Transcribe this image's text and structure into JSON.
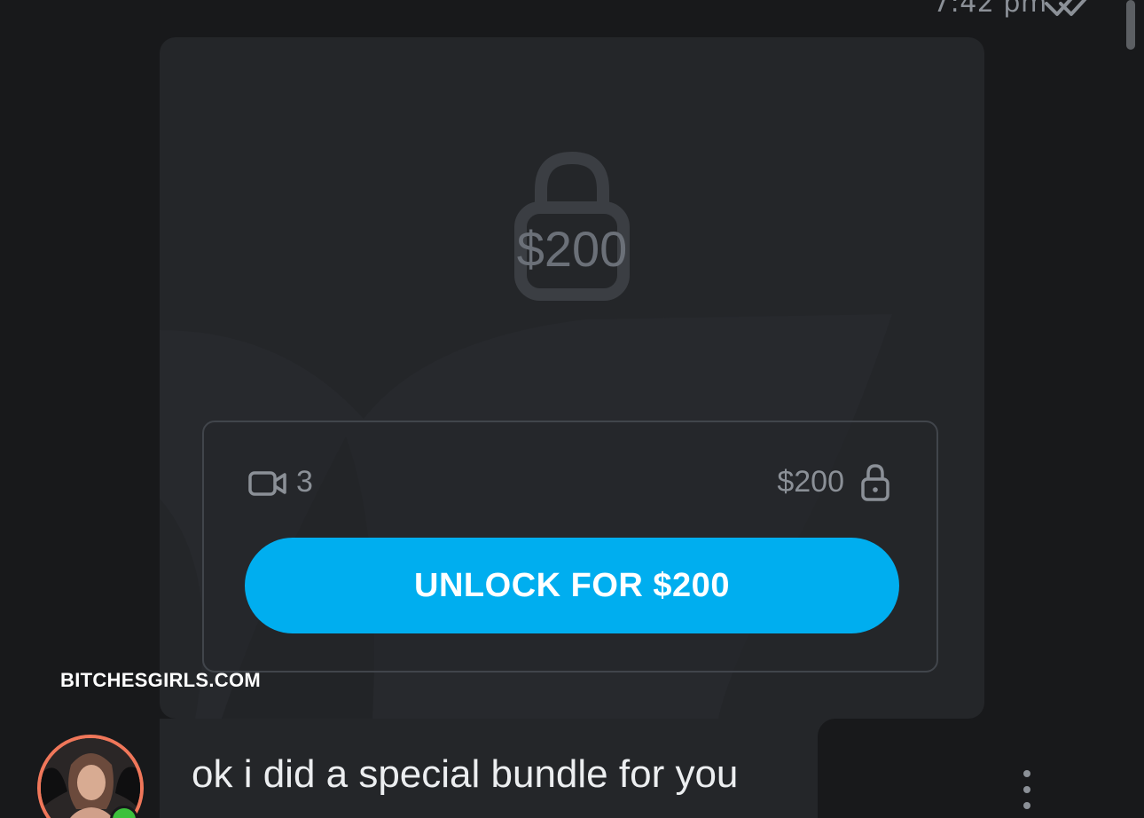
{
  "message": {
    "timestamp": "7:42 pm",
    "read_status_icon": "double-check-icon"
  },
  "locked_post": {
    "hero_price": "$200",
    "hero_icon": "lock-icon",
    "media": {
      "icon": "video-camera-icon",
      "count": "3"
    },
    "price": "$200",
    "price_icon": "lock-icon",
    "unlock_button_label": "UNLOCK FOR $200"
  },
  "watermark": "BITCHESGIRLS.COM",
  "text_message": {
    "text": "ok i did a special bundle for you",
    "avatar": "avatar",
    "online_status": "online",
    "menu_icon": "more-vertical-icon"
  },
  "colors": {
    "accent": "#00aeef",
    "background": "#18191b",
    "bubble": "#242629",
    "muted_text": "#8b9097",
    "avatar_ring": "#f0775a",
    "online": "#3cc13b"
  }
}
